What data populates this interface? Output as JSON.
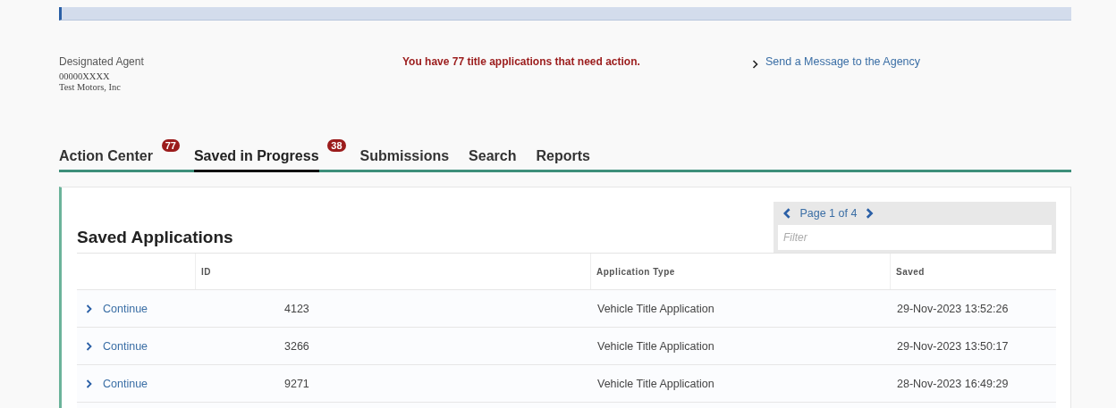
{
  "agent": {
    "label": "Designated Agent",
    "number": "00000XXXX",
    "company": "Test Motors, Inc"
  },
  "alert": "You have 77 title applications that need action.",
  "message_link": {
    "label": "Send a Message to the Agency"
  },
  "tabs": [
    {
      "label": "Action Center",
      "badge": "77",
      "selected": false
    },
    {
      "label": "Saved in Progress",
      "badge": "38",
      "selected": true
    },
    {
      "label": "Submissions",
      "selected": false
    },
    {
      "label": "Search",
      "selected": false
    },
    {
      "label": "Reports",
      "selected": false
    }
  ],
  "section_title": "Saved Applications",
  "pagination": {
    "label": "Page 1 of 4"
  },
  "filter": {
    "placeholder": "Filter"
  },
  "table": {
    "columns": [
      "ID",
      "Application Type",
      "Saved"
    ],
    "rows": [
      {
        "action": "Continue",
        "id": "4123",
        "type": "Vehicle Title Application",
        "saved": "29-Nov-2023 13:52:26"
      },
      {
        "action": "Continue",
        "id": "3266",
        "type": "Vehicle Title Application",
        "saved": "29-Nov-2023 13:50:17"
      },
      {
        "action": "Continue",
        "id": "9271",
        "type": "Vehicle Title Application",
        "saved": "28-Nov-2023 16:49:29"
      }
    ]
  }
}
